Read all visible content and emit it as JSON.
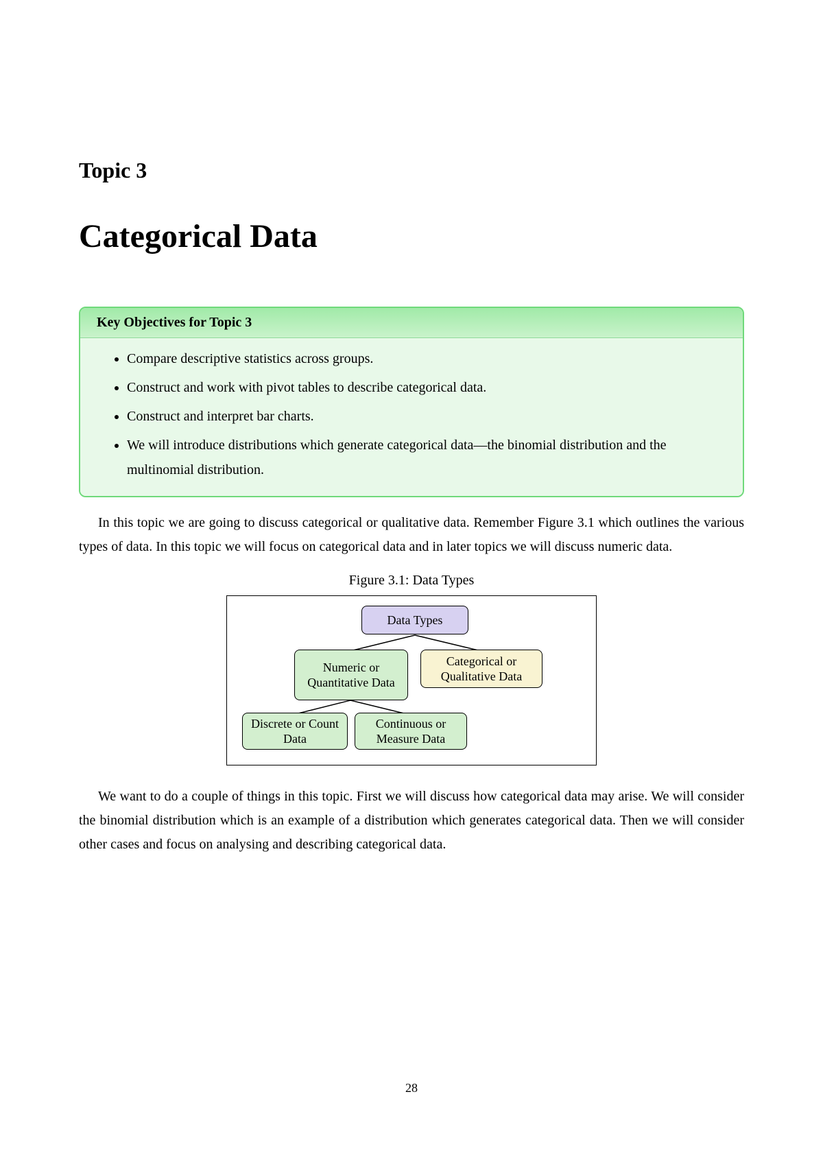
{
  "topic_label": "Topic 3",
  "title": "Categorical Data",
  "objectives": {
    "header": "Key Objectives for Topic 3",
    "items": [
      "Compare descriptive statistics across groups.",
      "Construct and work with pivot tables to describe categorical data.",
      "Construct and interpret bar charts.",
      "We will introduce distributions which generate categorical data—the binomial distribution and the multinomial distribution."
    ]
  },
  "para1": "In this topic we are going to discuss categorical or qualitative data. Remember Figure 3.1 which outlines the various types of data. In this topic we will focus on categorical data and in later topics we will discuss numeric data.",
  "figure_caption": "Figure 3.1: Data Types",
  "diagram": {
    "root": "Data Types",
    "left": "Numeric or Quantitative Data",
    "right": "Categorical or Qualitative Data",
    "leaf1": "Discrete or Count Data",
    "leaf2": "Continuous or Measure Data"
  },
  "para2": "We want to do a couple of things in this topic. First we will discuss how categorical data may arise. We will consider the binomial distribution which is an example of a distribution which generates categorical data. Then we will consider other cases and focus on analysing and describing categorical data.",
  "page_number": "28"
}
